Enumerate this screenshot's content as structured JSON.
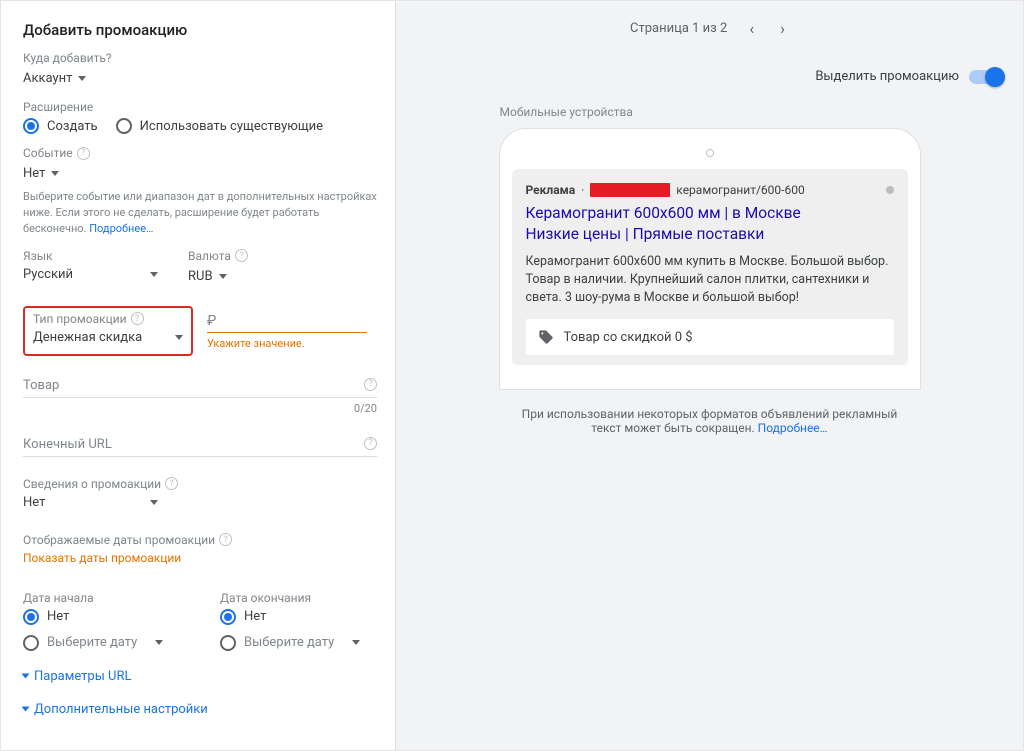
{
  "left": {
    "title": "Добавить промоакцию",
    "add_to_label": "Куда добавить?",
    "add_to_value": "Аккаунт",
    "extension_label": "Расширение",
    "ext_create": "Создать",
    "ext_existing": "Использовать существующие",
    "event_label": "Событие",
    "event_value": "Нет",
    "event_note_text": "Выберите событие или диапазон дат в дополнительных настройках ниже. Если этого не сделать, расширение будет работать бесконечно.",
    "event_note_link": "Подробнее…",
    "lang_label": "Язык",
    "lang_value": "Русский",
    "currency_label": "Валюта",
    "currency_value": "RUB",
    "promo_type_label": "Тип промоакции",
    "promo_type_value": "Денежная скидка",
    "promo_value_symbol": "₽",
    "promo_error": "Укажите значение.",
    "item_label": "Товар",
    "item_counter": "0/20",
    "final_url_label": "Конечный URL",
    "details_label": "Сведения о промоакции",
    "details_value": "Нет",
    "display_dates_label": "Отображаемые даты промоакции",
    "display_dates_link": "Показать даты промоакции",
    "start_date_label": "Дата начала",
    "end_date_label": "Дата окончания",
    "date_none": "Нет",
    "date_pick": "Выберите дату",
    "url_params": "Параметры URL",
    "advanced": "Дополнительные настройки"
  },
  "right": {
    "pager": "Страница 1 из 2",
    "highlight_label": "Выделить промоакцию",
    "preview_label": "Мобильные устройства",
    "ad_badge": "Реклама",
    "ad_url_tail": "керамогранит/600-600",
    "ad_title_line1": "Керамогранит 600х600 мм | в Москве",
    "ad_title_line2": "Низкие цены | Прямые поставки",
    "ad_desc": "Керамогранит 600х600 мм купить в Москве. Большой выбор. Товар в наличии. Крупнейший салон плитки, сантехники и света. 3 шоу-рума в Москве и большой выбор!",
    "promo_chip": "Товар со скидкой 0 $",
    "footer_note": "При использовании некоторых форматов объявлений рекламный текст может быть сокращен.",
    "footer_link": "Подробнее…"
  }
}
